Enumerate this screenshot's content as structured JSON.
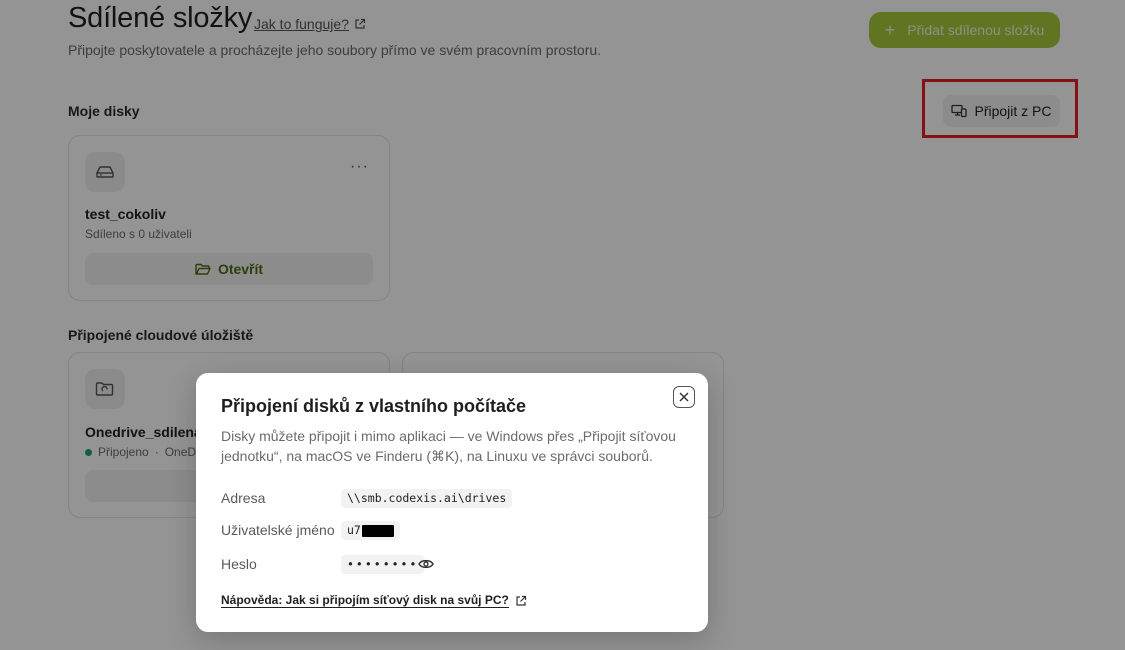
{
  "header": {
    "title": "Sdílené složky",
    "how_link": "Jak to funguje?",
    "subtitle": "Připojte poskytovatele a procházejte jeho soubory přímo ve svém pracovním prostoru.",
    "add_button": "Přidat sdílenou složku"
  },
  "my_drives": {
    "title": "Moje disky",
    "connect_pc_button": "Připojit z PC",
    "items": [
      {
        "name": "test_cokoliv",
        "meta": "Sdíleno s 0 uživateli",
        "open_label": "Otevřít",
        "menu": "···"
      }
    ]
  },
  "cloud": {
    "title": "Připojené cloudové úložiště",
    "items": [
      {
        "name": "Onedrive_sdilena",
        "status": "Připojeno",
        "provider": "OneD"
      }
    ]
  },
  "dialog": {
    "title": "Připojení disků z vlastního počítače",
    "description": "Disky můžete připojit i mimo aplikaci — ve Windows přes „Připojit síťovou jednotku“, na macOS ve Finderu (⌘K), na Linuxu ve správci souborů.",
    "address_label": "Adresa",
    "address_value": "\\\\smb.codexis.ai\\drives",
    "username_label": "Uživatelské jméno",
    "username_value": "u7",
    "password_label": "Heslo",
    "password_value": "••••••••",
    "help_link": "Nápověda: Jak si připojím síťový disk na svůj PC?"
  },
  "colors": {
    "accent": "#a8c93a",
    "open_text": "#4e6b12",
    "status_ok": "#22a06b",
    "highlight": "#e31e24"
  }
}
